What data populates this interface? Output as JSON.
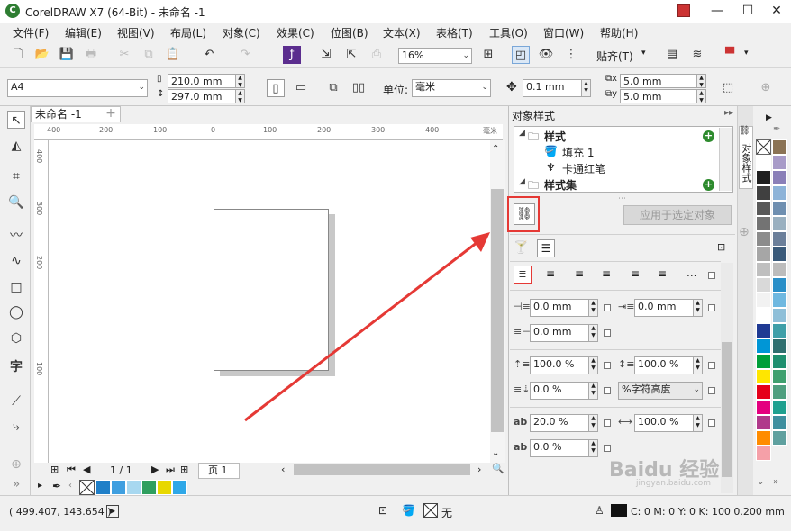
{
  "window": {
    "title": "CorelDRAW X7 (64-Bit) - 未命名 -1",
    "minimize": "—",
    "maximize": "☐",
    "close": "✕"
  },
  "menu": [
    "文件(F)",
    "编辑(E)",
    "视图(V)",
    "布局(L)",
    "对象(C)",
    "效果(C)",
    "位图(B)",
    "文本(X)",
    "表格(T)",
    "工具(O)",
    "窗口(W)",
    "帮助(H)"
  ],
  "toolbar": {
    "zoom": "16%",
    "snap": "贴齐(T)"
  },
  "propbar": {
    "paper": "A4",
    "width": "210.0 mm",
    "height": "297.0 mm",
    "unit_label": "单位:",
    "unit": "毫米",
    "nudge": "0.1 mm",
    "dup_x": "5.0 mm",
    "dup_y": "5.0 mm"
  },
  "document": {
    "tab": "未命名 -1",
    "page_count": "1 / 1",
    "page_tab": "页 1"
  },
  "ruler_h": [
    "400",
    "200",
    "100",
    "0",
    "100",
    "200",
    "300",
    "400",
    "毫米"
  ],
  "ruler_v": [
    "400",
    "300",
    "200",
    "100"
  ],
  "panel": {
    "title": "对象样式",
    "tree": [
      {
        "label": "样式",
        "bold": true
      },
      {
        "label": "填充 1",
        "bold": false
      },
      {
        "label": "卡通红笔",
        "bold": false
      },
      {
        "label": "样式集",
        "bold": true
      }
    ],
    "apply_button": "应用于选定对象",
    "fields": {
      "indent_left": "0.0 mm",
      "indent_right": "0.0 mm",
      "first_line": "0.0 mm",
      "line_spacing": "100.0 %",
      "char_spacing": "100.0 %",
      "before_para": "0.0 %",
      "spacing_unit": "%字符高度",
      "word_spacing": "20.0 %",
      "lang_spacing": "100.0 %",
      "after_para": "0.0 %"
    },
    "ellipsis": "..."
  },
  "side_tab": "对象样式",
  "status": {
    "coords": "( 499.407, 143.654 )",
    "fill": "无",
    "outline": "C: 0 M: 0 Y: 0 K: 100  0.200 mm"
  },
  "watermark": "Baidu 经验",
  "watermark_sub": "jingyan.baidu.com",
  "colors": {
    "accent_red": "#e53935",
    "palette_left": [
      "#ffffff",
      "#1f1f1f",
      "#404040",
      "#595959",
      "#737373",
      "#8c8c8c",
      "#a6a6a6",
      "#bfbfbf",
      "#d9d9d9",
      "#f2f2f2",
      "#ffffff",
      "#1f3a93",
      "#0096d6",
      "#009f3a",
      "#ffe600",
      "#e5001a",
      "#e4007f",
      "#b03a8b",
      "#ff8c00",
      "#f5a0a8"
    ],
    "palette_right": [
      "#8b7355",
      "#a89bc8",
      "#8a7fb8",
      "#8db3d8",
      "#6f8fb0",
      "#9ab0c0",
      "#6b7f9a",
      "#3a5a7a",
      "#bcbcbc",
      "#2a8fc8",
      "#6fb8e0",
      "#8fbfd8",
      "#3f9fa8",
      "#2f6f6f",
      "#1f8f6f",
      "#3fa06f",
      "#4f9f7f",
      "#1fa08f",
      "#3f8f9f",
      "#5fa09f"
    ],
    "bottom_swatches": [
      "#1f7fc8",
      "#3f9fe0",
      "#a8d8f0",
      "#2f9f5f",
      "#e8d800",
      "#2fa8e8"
    ]
  }
}
